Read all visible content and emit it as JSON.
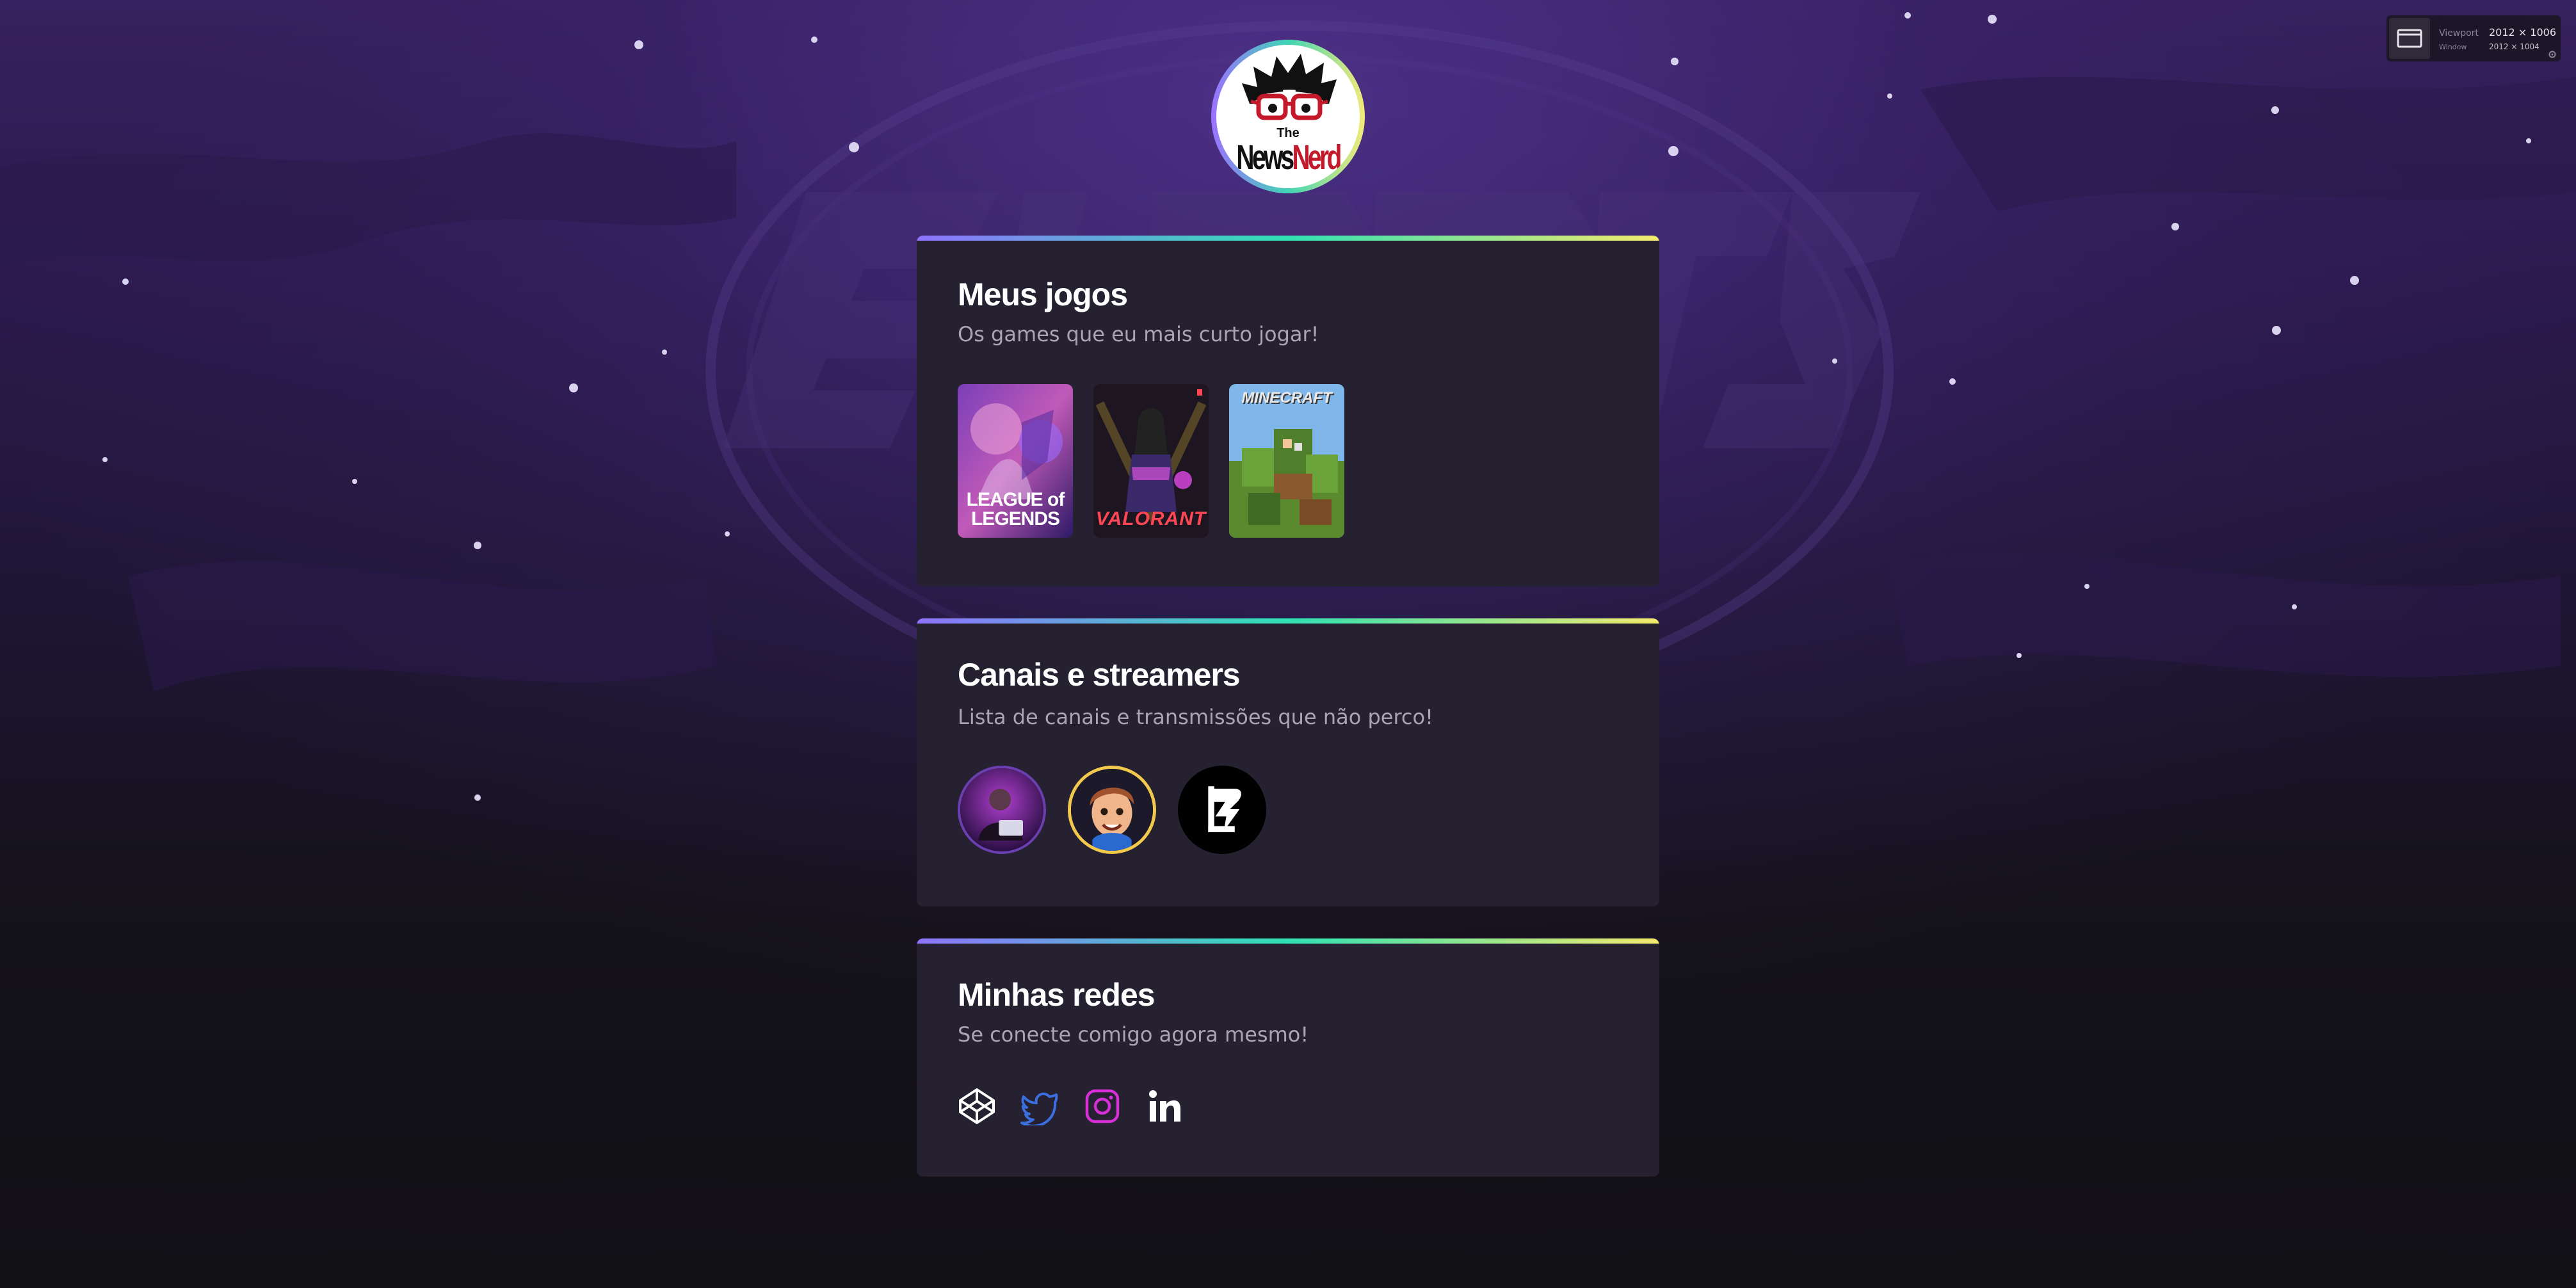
{
  "viewport_widget": {
    "viewport_label": "Viewport",
    "viewport_value": "2012 × 1006",
    "window_label": "Window",
    "window_value": "2012 × 1004"
  },
  "profile": {
    "logo_small": "The",
    "logo_news": "News",
    "logo_nerd": "Nerd"
  },
  "sections": {
    "games": {
      "title": "Meus jogos",
      "subtitle": "Os games que eu mais curto jogar!",
      "items": [
        {
          "name": "League of Legends",
          "cover_text": "LEAGUE of LEGENDS",
          "icon": "league-of-legends-cover"
        },
        {
          "name": "Valorant",
          "cover_text": "VALORANT",
          "icon": "valorant-cover"
        },
        {
          "name": "Minecraft",
          "cover_text": "MINECRAFT",
          "icon": "minecraft-cover"
        }
      ]
    },
    "channels": {
      "title": "Canais e streamers",
      "subtitle": "Lista de canais e transmissões que não perco!",
      "items": [
        {
          "icon": "streamer-purple-avatar",
          "ring_color": "#6a3fb0"
        },
        {
          "icon": "streamer-cartoon-avatar",
          "ring_color": "#f2c94c"
        },
        {
          "icon": "rocketseat-avatar",
          "ring_color": "#000000"
        }
      ]
    },
    "socials": {
      "title": "Minhas redes",
      "subtitle": "Se conecte comigo agora mesmo!",
      "items": [
        {
          "icon": "codepen-icon",
          "color": "#ffffff"
        },
        {
          "icon": "twitter-icon",
          "color": "#3b6fe0"
        },
        {
          "icon": "instagram-icon",
          "color": "#d62fd6"
        },
        {
          "icon": "linkedin-icon",
          "color": "#ffffff"
        }
      ]
    }
  },
  "colors": {
    "accent_gradient": [
      "#8f73ff",
      "#30e1b3",
      "#f3ea6c"
    ],
    "card_background": "#252131",
    "page_background_top": "#37205f",
    "page_background_bottom": "#111015"
  }
}
